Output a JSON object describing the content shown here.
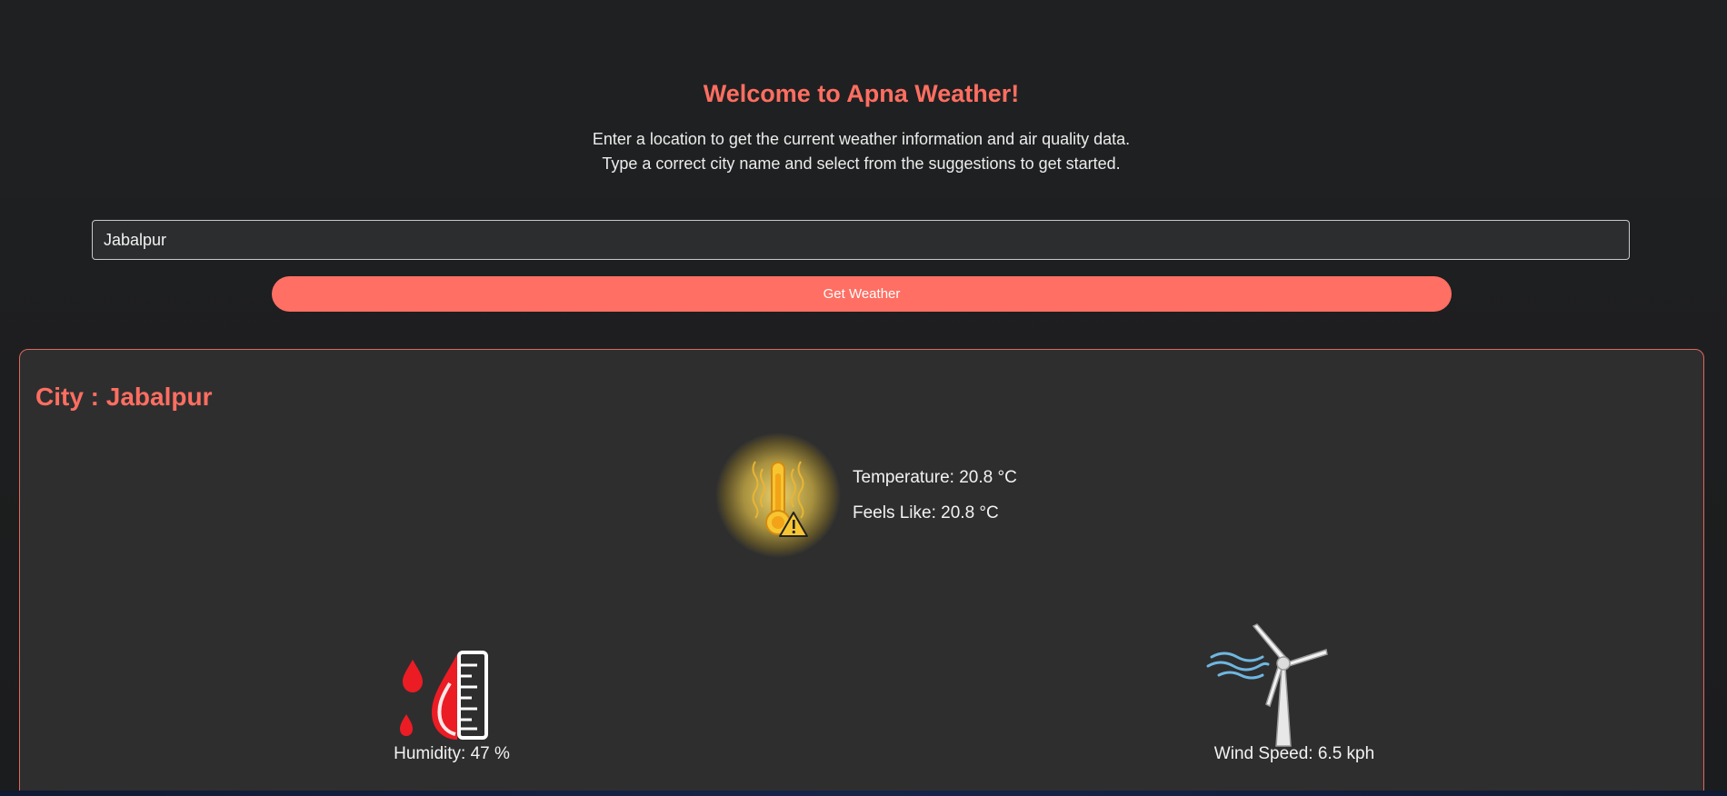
{
  "header": {
    "title": "Welcome to Apna Weather!",
    "line1": "Enter a location to get the current weather information and air quality data.",
    "line2": "Type a correct city name and select from the suggestions to get started."
  },
  "search": {
    "value": "Jabalpur",
    "button_label": "Get Weather"
  },
  "result": {
    "city_heading": "City : Jabalpur",
    "temperature": "Temperature: 20.8 °C",
    "feels_like": "Feels Like: 20.8 °C",
    "humidity": "Humidity: 47 %",
    "wind_speed": "Wind Speed: 6.5 kph"
  },
  "icons": {
    "temperature": "thermometer-warning-icon",
    "humidity": "humidity-drops-icon",
    "wind": "wind-turbine-icon"
  },
  "colors": {
    "accent": "#ff6e61",
    "button": "#ff6f63",
    "card_bg": "#2e2e2f",
    "card_border": "#e0665c",
    "page_bg": "#1c1d1e"
  }
}
